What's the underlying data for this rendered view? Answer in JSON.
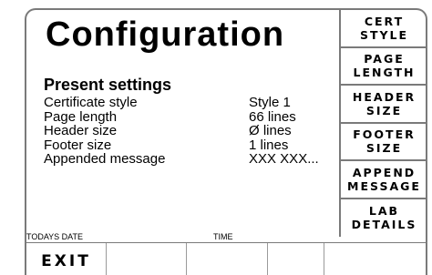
{
  "screen": {
    "title": "Configuration"
  },
  "present_settings": {
    "heading": "Present settings",
    "rows": [
      {
        "label": "Certificate style",
        "value": "Style 1"
      },
      {
        "label": "Page length",
        "value": "66 lines"
      },
      {
        "label": "Header size",
        "value": "Ø lines"
      },
      {
        "label": "Footer size",
        "value": "1 lines"
      },
      {
        "label": "Appended message",
        "value": "XXX XXX..."
      }
    ]
  },
  "side_buttons": [
    {
      "line1": "CERT",
      "line2": "STYLE"
    },
    {
      "line1": "PAGE",
      "line2": "LENGTH"
    },
    {
      "line1": "HEADER",
      "line2": "SIZE"
    },
    {
      "line1": "FOOTER",
      "line2": "SIZE"
    },
    {
      "line1": "APPEND",
      "line2": "MESSAGE"
    },
    {
      "line1": "LAB",
      "line2": "DETAILS"
    }
  ],
  "status": {
    "date_label": "TODAYS DATE",
    "time_label": "TIME"
  },
  "bottom_buttons": {
    "exit": "EXIT"
  }
}
